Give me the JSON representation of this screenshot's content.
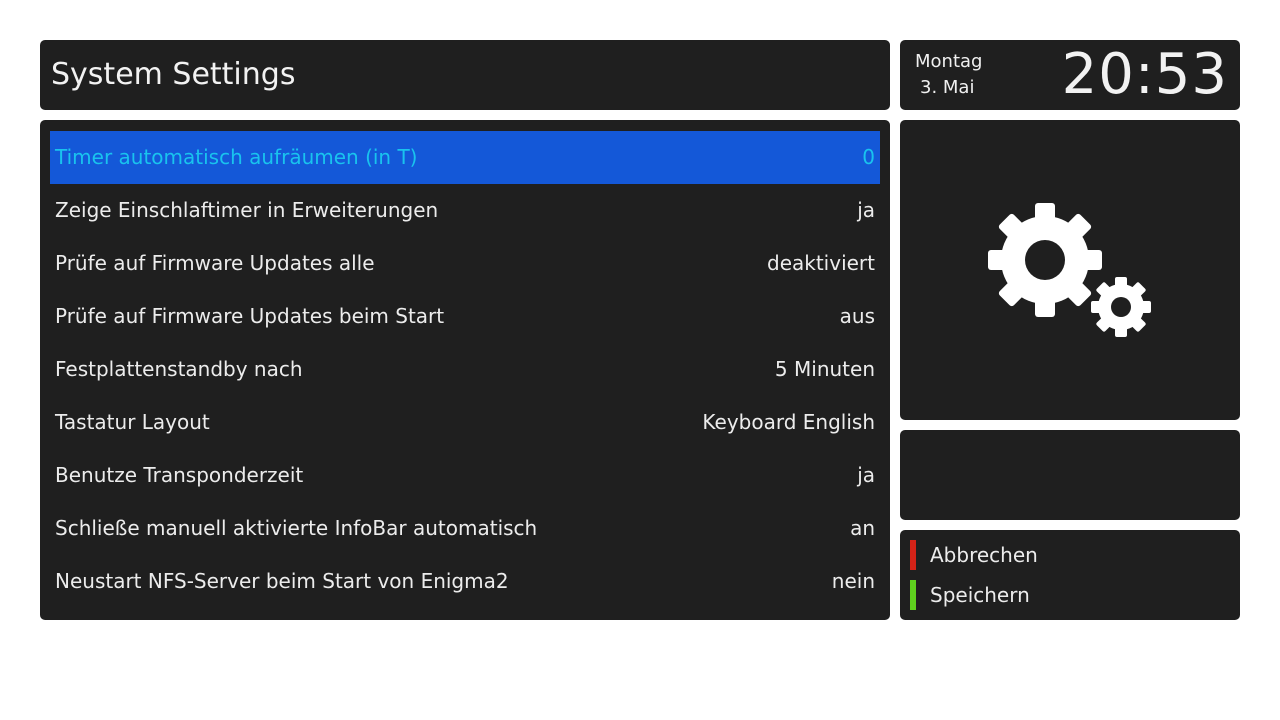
{
  "header": {
    "title": "System Settings"
  },
  "clock": {
    "day": "Montag",
    "date": "3. Mai",
    "time": "20:53"
  },
  "settings": [
    {
      "label": "Timer automatisch aufräumen (in T)",
      "value": "0",
      "selected": true
    },
    {
      "label": "Zeige Einschlaftimer in Erweiterungen",
      "value": "ja"
    },
    {
      "label": "Prüfe auf Firmware Updates alle",
      "value": "deaktiviert"
    },
    {
      "label": "Prüfe auf Firmware Updates beim Start",
      "value": "aus"
    },
    {
      "label": "Festplattenstandby nach",
      "value": "5 Minuten"
    },
    {
      "label": "Tastatur Layout",
      "value": "Keyboard English"
    },
    {
      "label": "Benutze Transponderzeit",
      "value": "ja"
    },
    {
      "label": "Schließe manuell aktivierte InfoBar automatisch",
      "value": "an"
    },
    {
      "label": "Neustart NFS-Server beim Start von Enigma2",
      "value": "nein"
    }
  ],
  "icon": {
    "name": "gears-icon"
  },
  "buttons": {
    "red": {
      "label": "Abbrechen",
      "color": "#d42318"
    },
    "green": {
      "label": "Speichern",
      "color": "#5fd11e"
    }
  },
  "colors": {
    "panel": "#1f1f1f",
    "selection_bg": "#1458d8",
    "selection_text": "#19c3ee",
    "text": "#ececec"
  }
}
